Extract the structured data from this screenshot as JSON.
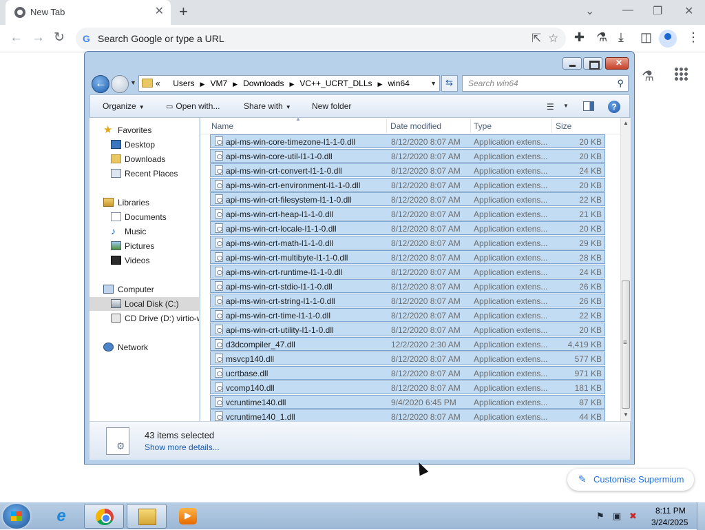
{
  "browser": {
    "tab_title": "New Tab",
    "tab_close": "✕",
    "new_tab": "+",
    "omnibox_placeholder": "Search Google or type a URL",
    "customise_label": "Customise Supermium"
  },
  "dialog": {
    "breadcrumbs": [
      "«",
      "Users",
      "VM7",
      "Downloads",
      "VC++_UCRT_DLLs",
      "win64"
    ],
    "search_placeholder": "Search win64",
    "commands": {
      "organize": "Organize",
      "open_with": "Open with...",
      "share_with": "Share with",
      "new_folder": "New folder"
    },
    "columns": {
      "name": "Name",
      "date": "Date modified",
      "type": "Type",
      "size": "Size"
    },
    "nav": [
      {
        "label": "Favorites",
        "icon": "star-icon"
      },
      {
        "label": "Desktop",
        "icon": "desktop-icon"
      },
      {
        "label": "Downloads",
        "icon": "downloads-folder-icon"
      },
      {
        "label": "Recent Places",
        "icon": "recent-places-icon"
      },
      {
        "label": "Libraries",
        "icon": "libraries-icon"
      },
      {
        "label": "Documents",
        "icon": "documents-icon"
      },
      {
        "label": "Music",
        "icon": "music-icon"
      },
      {
        "label": "Pictures",
        "icon": "pictures-icon"
      },
      {
        "label": "Videos",
        "icon": "videos-icon"
      },
      {
        "label": "Computer",
        "icon": "computer-icon"
      },
      {
        "label": "Local Disk (C:)",
        "icon": "local-disk-icon"
      },
      {
        "label": "CD Drive (D:) virtio-w",
        "icon": "cd-drive-icon"
      },
      {
        "label": "Network",
        "icon": "network-icon"
      }
    ],
    "files": [
      {
        "name": "api-ms-win-core-timezone-l1-1-0.dll",
        "date": "8/12/2020 8:07 AM",
        "type": "Application extens...",
        "size": "20 KB"
      },
      {
        "name": "api-ms-win-core-util-l1-1-0.dll",
        "date": "8/12/2020 8:07 AM",
        "type": "Application extens...",
        "size": "20 KB"
      },
      {
        "name": "api-ms-win-crt-convert-l1-1-0.dll",
        "date": "8/12/2020 8:07 AM",
        "type": "Application extens...",
        "size": "24 KB"
      },
      {
        "name": "api-ms-win-crt-environment-l1-1-0.dll",
        "date": "8/12/2020 8:07 AM",
        "type": "Application extens...",
        "size": "20 KB"
      },
      {
        "name": "api-ms-win-crt-filesystem-l1-1-0.dll",
        "date": "8/12/2020 8:07 AM",
        "type": "Application extens...",
        "size": "22 KB"
      },
      {
        "name": "api-ms-win-crt-heap-l1-1-0.dll",
        "date": "8/12/2020 8:07 AM",
        "type": "Application extens...",
        "size": "21 KB"
      },
      {
        "name": "api-ms-win-crt-locale-l1-1-0.dll",
        "date": "8/12/2020 8:07 AM",
        "type": "Application extens...",
        "size": "20 KB"
      },
      {
        "name": "api-ms-win-crt-math-l1-1-0.dll",
        "date": "8/12/2020 8:07 AM",
        "type": "Application extens...",
        "size": "29 KB"
      },
      {
        "name": "api-ms-win-crt-multibyte-l1-1-0.dll",
        "date": "8/12/2020 8:07 AM",
        "type": "Application extens...",
        "size": "28 KB"
      },
      {
        "name": "api-ms-win-crt-runtime-l1-1-0.dll",
        "date": "8/12/2020 8:07 AM",
        "type": "Application extens...",
        "size": "24 KB"
      },
      {
        "name": "api-ms-win-crt-stdio-l1-1-0.dll",
        "date": "8/12/2020 8:07 AM",
        "type": "Application extens...",
        "size": "26 KB"
      },
      {
        "name": "api-ms-win-crt-string-l1-1-0.dll",
        "date": "8/12/2020 8:07 AM",
        "type": "Application extens...",
        "size": "26 KB"
      },
      {
        "name": "api-ms-win-crt-time-l1-1-0.dll",
        "date": "8/12/2020 8:07 AM",
        "type": "Application extens...",
        "size": "22 KB"
      },
      {
        "name": "api-ms-win-crt-utility-l1-1-0.dll",
        "date": "8/12/2020 8:07 AM",
        "type": "Application extens...",
        "size": "20 KB"
      },
      {
        "name": "d3dcompiler_47.dll",
        "date": "12/2/2020 2:30 AM",
        "type": "Application extens...",
        "size": "4,419 KB"
      },
      {
        "name": "msvcp140.dll",
        "date": "8/12/2020 8:07 AM",
        "type": "Application extens...",
        "size": "577 KB"
      },
      {
        "name": "ucrtbase.dll",
        "date": "8/12/2020 8:07 AM",
        "type": "Application extens...",
        "size": "971 KB"
      },
      {
        "name": "vcomp140.dll",
        "date": "8/12/2020 8:07 AM",
        "type": "Application extens...",
        "size": "181 KB"
      },
      {
        "name": "vcruntime140.dll",
        "date": "9/4/2020 6:45 PM",
        "type": "Application extens...",
        "size": "87 KB"
      },
      {
        "name": "vcruntime140_1.dll",
        "date": "8/12/2020 8:07 AM",
        "type": "Application extens...",
        "size": "44 KB"
      }
    ],
    "details": {
      "count": "43 items selected",
      "link": "Show more details..."
    }
  },
  "taskbar": {
    "time": "8:11 PM",
    "date": "3/24/2025"
  },
  "colors": {
    "selection_fill": "#c2dcf3",
    "selection_border": "#7da2ce",
    "accent": "#1a73e8"
  }
}
